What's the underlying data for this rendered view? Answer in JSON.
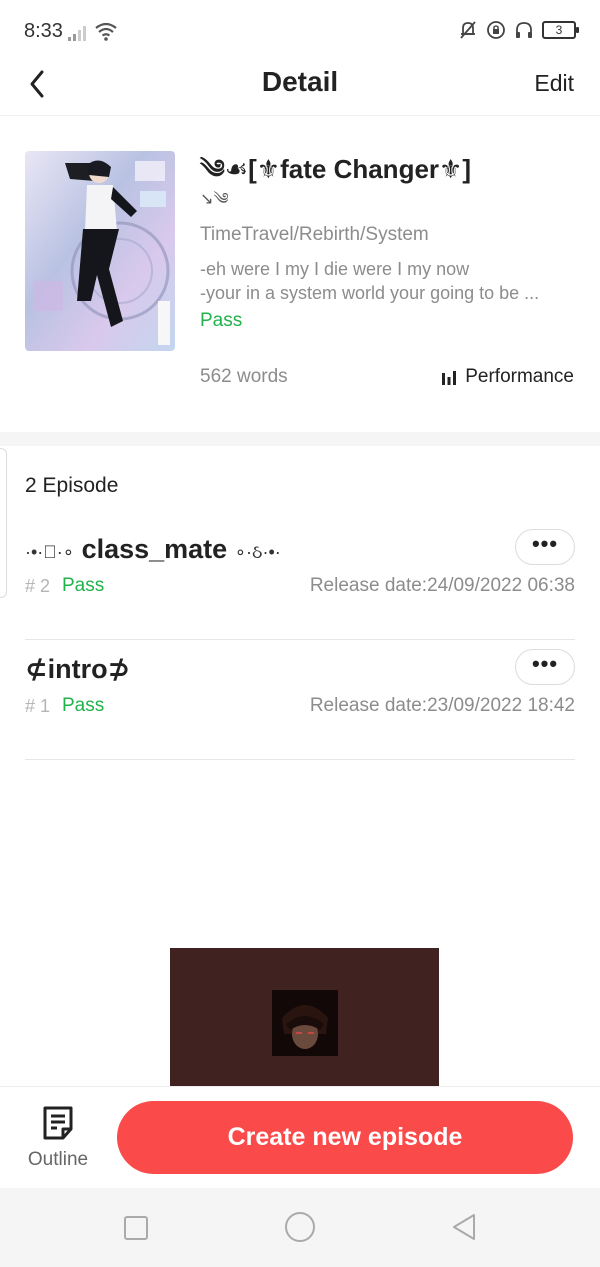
{
  "status_bar": {
    "time": "8:33",
    "battery": "3"
  },
  "header": {
    "title": "Detail",
    "edit_label": "Edit"
  },
  "book": {
    "title_main": "༄☙[⚜fate Changer⚜]",
    "title_sub": "↘༄",
    "genre": "TimeTravel/Rebirth/System",
    "synopsis_line1": "-eh were I my I die were I my now",
    "synopsis_line2": "-your in a system world your going to be ...",
    "status": "Pass",
    "words": "562 words",
    "performance_label": "Performance"
  },
  "episodes_header": "2 Episode",
  "episodes": [
    {
      "title_prefix": "·•·ঃ·∘",
      "title": "class_mate",
      "title_suffix": "∘·ઠ·•·",
      "number": "# 2",
      "status": "Pass",
      "release": "Release date:24/09/2022 06:38",
      "more": "•••"
    },
    {
      "title_prefix": "",
      "title": "⊄intro⊅",
      "title_suffix": "",
      "number": "# 1",
      "status": "Pass",
      "release": "Release date:23/09/2022 18:42",
      "more": "•••"
    }
  ],
  "bottom": {
    "outline_label": "Outline",
    "create_label": "Create new episode"
  },
  "colors": {
    "accent": "#fb4a4a",
    "pass_green": "#22b24c",
    "muted": "#8c8c8c",
    "thumb_bg": "#402320"
  }
}
